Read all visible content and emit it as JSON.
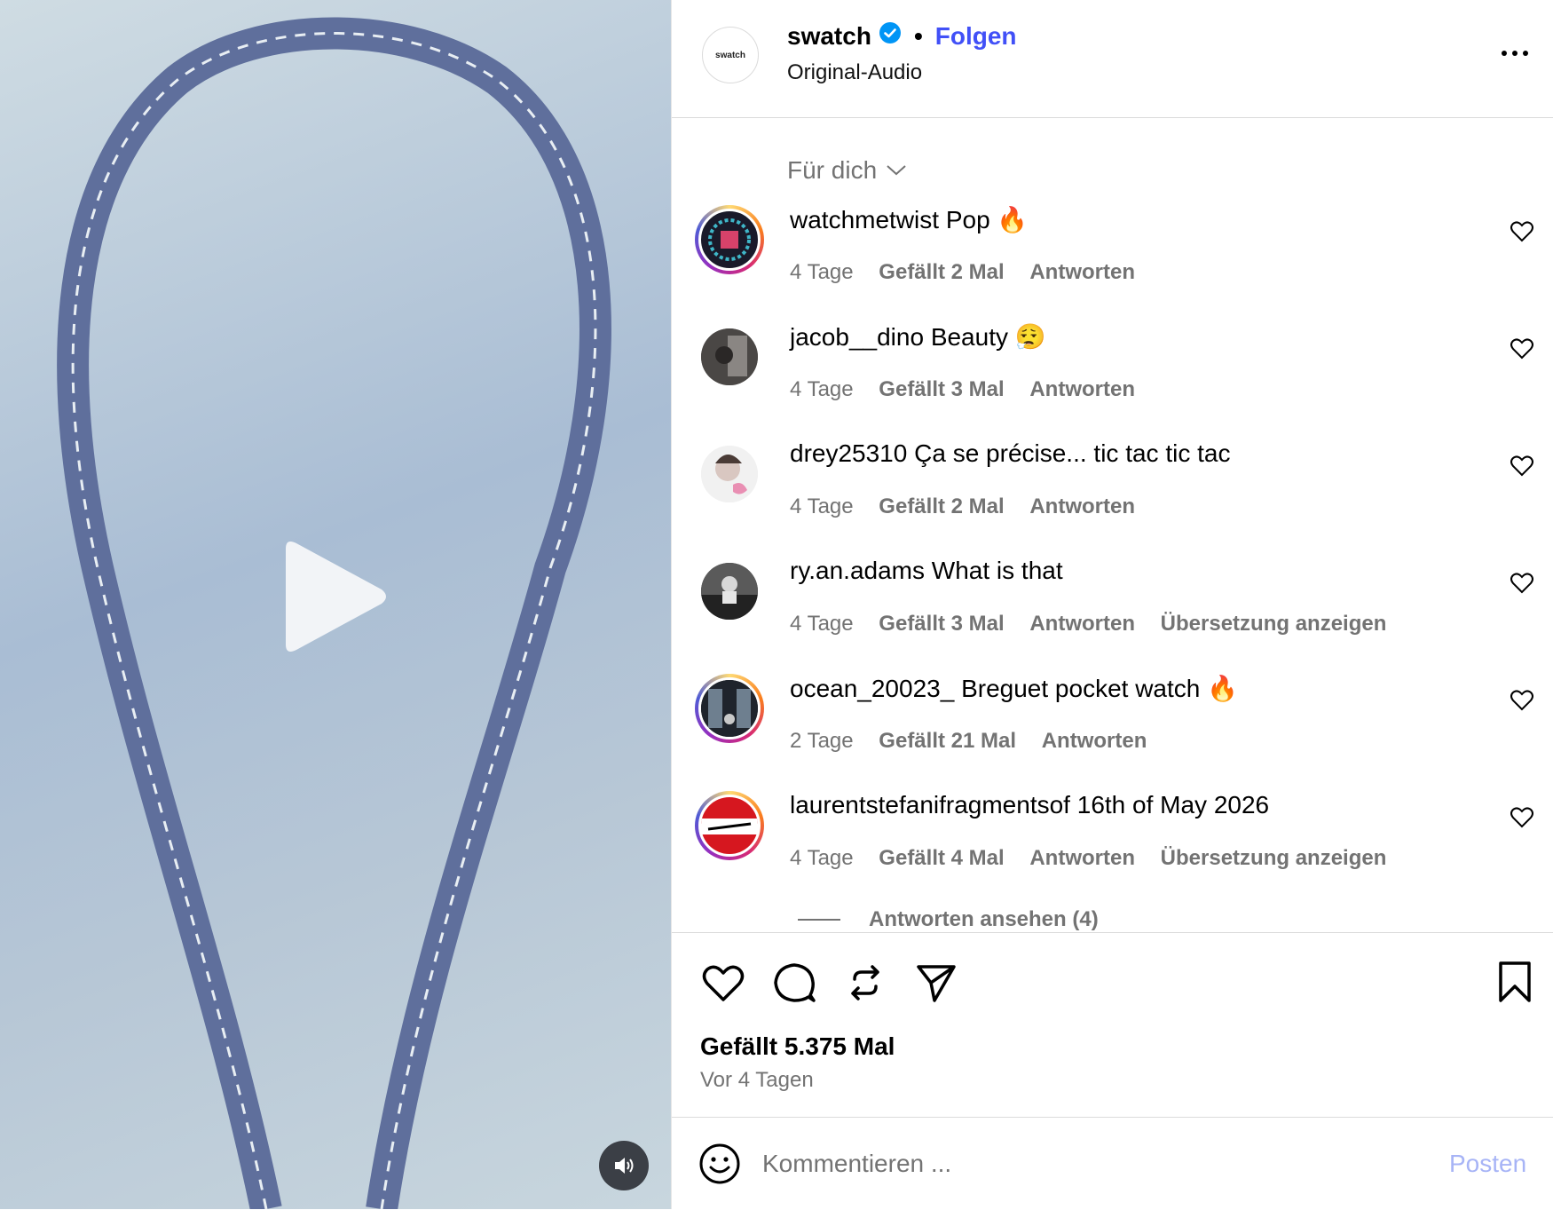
{
  "colors": {
    "accent": "#4150f7",
    "muted": "#737373",
    "post_disabled": "#a7b4f6",
    "strap": "#5f6f9c"
  },
  "header": {
    "avatar_text": "swatch",
    "username": "swatch",
    "separator": "•",
    "follow_label": "Folgen",
    "audio": "Original-Audio"
  },
  "sort": {
    "label": "Für dich"
  },
  "comments": [
    {
      "user": "watchmetwist",
      "text": "Pop 🔥",
      "age": "4 Tage",
      "likes": "Gefällt 2 Mal",
      "reply": "Antworten",
      "translate": ""
    },
    {
      "user": "jacob__dino",
      "text": "Beauty 😮‍💨",
      "age": "4 Tage",
      "likes": "Gefällt 3 Mal",
      "reply": "Antworten",
      "translate": ""
    },
    {
      "user": "drey25310",
      "text": "Ça se précise... tic tac tic tac",
      "age": "4 Tage",
      "likes": "Gefällt 2 Mal",
      "reply": "Antworten",
      "translate": ""
    },
    {
      "user": "ry.an.adams",
      "text": "What is that",
      "age": "4 Tage",
      "likes": "Gefällt 3 Mal",
      "reply": "Antworten",
      "translate": "Übersetzung anzeigen"
    },
    {
      "user": "ocean_20023_",
      "text": "Breguet pocket watch 🔥",
      "age": "2 Tage",
      "likes": "Gefällt 21 Mal",
      "reply": "Antworten",
      "translate": ""
    },
    {
      "user": "laurentstefanifragmentsof",
      "text": "16th of May 2026",
      "age": "4 Tage",
      "likes": "Gefällt 4 Mal",
      "reply": "Antworten",
      "translate": "Übersetzung anzeigen"
    }
  ],
  "view_replies": "Antworten ansehen (4)",
  "post_stats": {
    "likes": "Gefällt 5.375 Mal",
    "time": "Vor 4 Tagen"
  },
  "composer": {
    "placeholder": "Kommentieren ...",
    "post_label": "Posten"
  }
}
